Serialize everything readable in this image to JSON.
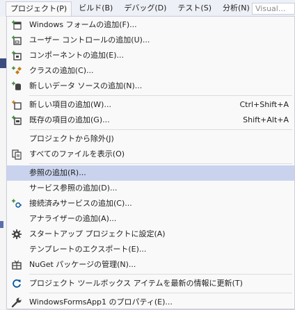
{
  "menubar": {
    "items": [
      "プロジェクト(P)",
      "ビルド(B)",
      "デバッグ(D)",
      "テスト(S)",
      "分析(N)"
    ],
    "search_placeholder": "Visual..."
  },
  "menu": {
    "items": [
      {
        "label": "Windows フォームの追加(F)...",
        "icon": "add-form-icon"
      },
      {
        "label": "ユーザー コントロールの追加(U)...",
        "icon": "user-control-icon"
      },
      {
        "label": "コンポーネントの追加(E)...",
        "icon": "component-icon"
      },
      {
        "label": "クラスの追加(C)...",
        "icon": "class-icon"
      },
      {
        "label": "新しいデータ ソースの追加(N)...",
        "icon": "data-source-icon"
      },
      {
        "label": "新しい項目の追加(W)...",
        "icon": "new-item-icon",
        "shortcut": "Ctrl+Shift+A"
      },
      {
        "label": "既存の項目の追加(G)...",
        "icon": "existing-item-icon",
        "shortcut": "Shift+Alt+A"
      },
      {
        "label": "プロジェクトから除外(J)",
        "icon": ""
      },
      {
        "label": "すべてのファイルを表示(O)",
        "icon": "show-all-files-icon"
      },
      {
        "label": "参照の追加(R)...",
        "icon": ""
      },
      {
        "label": "サービス参照の追加(D)...",
        "icon": ""
      },
      {
        "label": "接続済みサービスの追加(C)...",
        "icon": "connected-service-icon"
      },
      {
        "label": "アナライザーの追加(A)...",
        "icon": ""
      },
      {
        "label": "スタートアップ プロジェクトに設定(A)",
        "icon": "gear-icon"
      },
      {
        "label": "テンプレートのエクスポート(E)...",
        "icon": ""
      },
      {
        "label": "NuGet パッケージの管理(N)...",
        "icon": "nuget-icon"
      },
      {
        "label": "プロジェクト ツールボックス アイテムを最新の情報に更新(T)",
        "icon": "refresh-icon"
      },
      {
        "label": "WindowsFormsApp1 のプロパティ(E)...",
        "icon": "wrench-icon"
      }
    ],
    "highlighted": "参照の追加(R)..."
  },
  "colors": {
    "highlight": "#c9d3ee",
    "icon_blue": "#00539c",
    "icon_green": "#388a34",
    "icon_dark": "#424242"
  }
}
